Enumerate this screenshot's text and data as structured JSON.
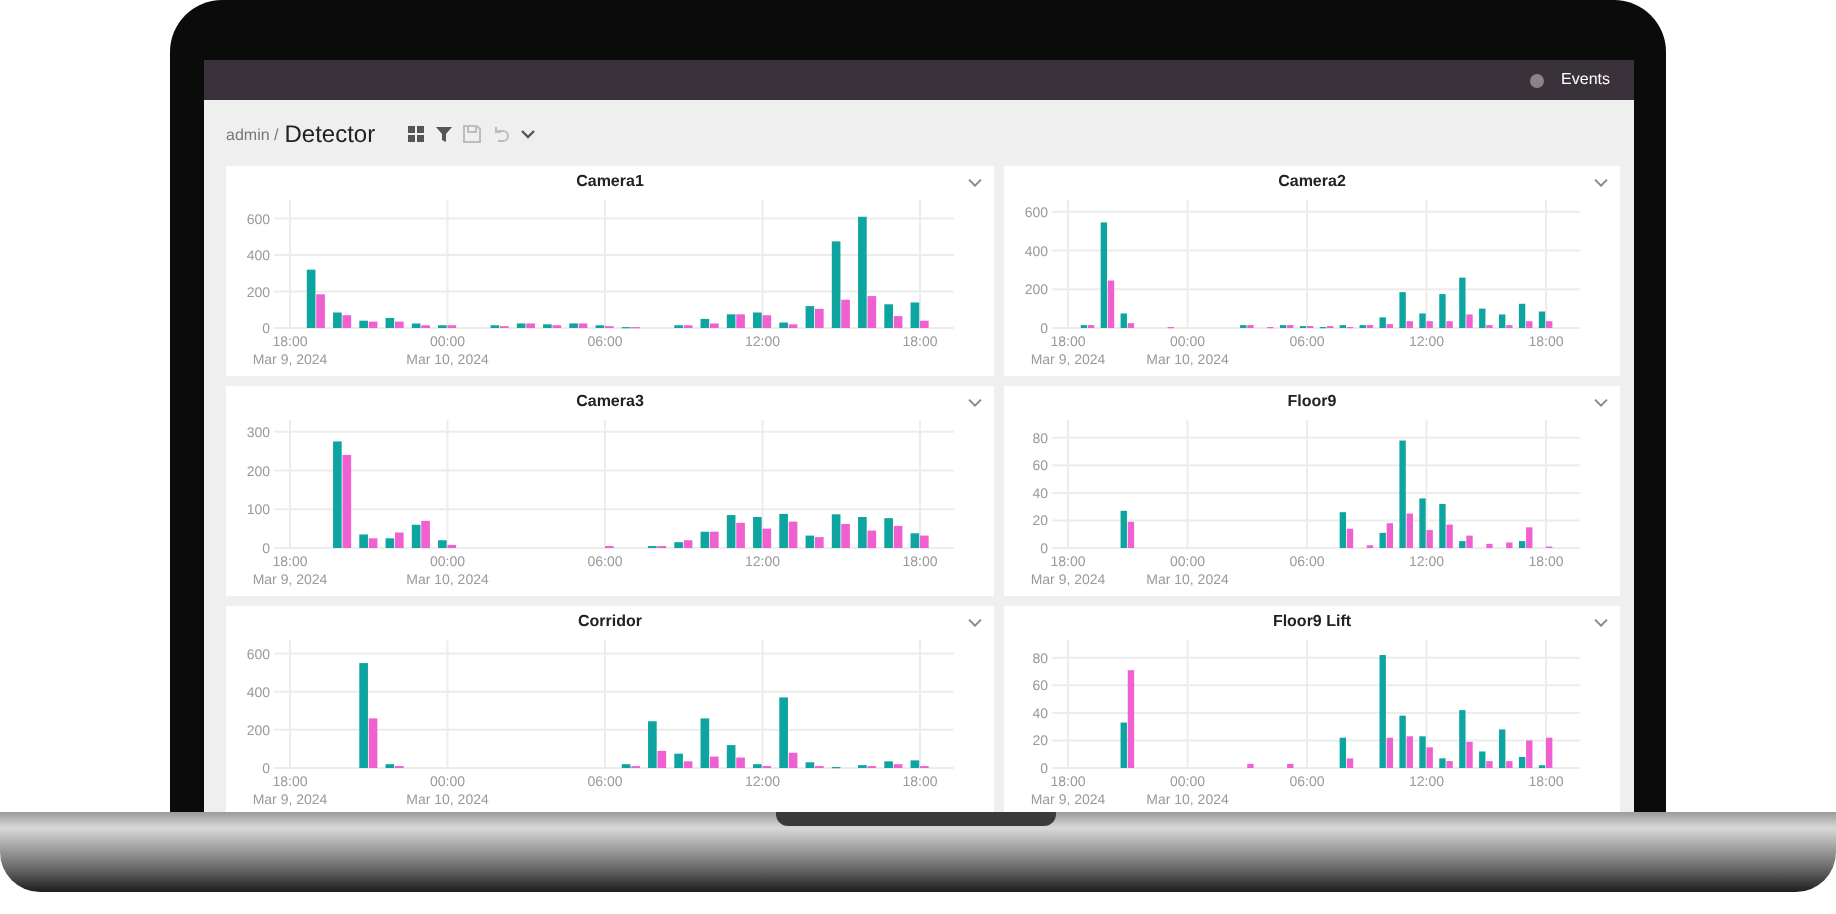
{
  "top_bar": {
    "link": "Events"
  },
  "breadcrumb": {
    "parent": "admin /",
    "current": "Detector"
  },
  "toolbar": [
    {
      "kind": "layout",
      "disabled": false
    },
    {
      "kind": "filter",
      "disabled": false
    },
    {
      "kind": "save",
      "disabled": true
    },
    {
      "kind": "undo",
      "disabled": true
    },
    {
      "kind": "more",
      "disabled": false
    }
  ],
  "panels": [
    {
      "title": "Camera1",
      "chart_data": {
        "type": "bar",
        "grid": true,
        "categories": [
          "18:00",
          null,
          null,
          null,
          null,
          null,
          "00:00",
          null,
          null,
          null,
          null,
          null,
          "06:00",
          null,
          null,
          null,
          null,
          null,
          "12:00",
          null,
          null,
          null,
          null,
          null,
          "18:00"
        ],
        "ylim": [
          0,
          680
        ],
        "yticks": [
          0,
          200,
          400,
          600
        ],
        "annotations": [
          "Mar 9, 2024",
          "Mar 10, 2024"
        ],
        "series": [
          {
            "color": "#0ea5a0",
            "values": [
              null,
              320,
              85,
              40,
              55,
              25,
              15,
              null,
              15,
              25,
              20,
              25,
              15,
              5,
              null,
              15,
              50,
              75,
              85,
              30,
              120,
              475,
              610,
              130,
              140
            ]
          },
          {
            "color": "#f060d0",
            "values": [
              null,
              185,
              70,
              35,
              35,
              15,
              15,
              null,
              10,
              25,
              15,
              25,
              10,
              5,
              null,
              15,
              25,
              75,
              70,
              20,
              105,
              155,
              175,
              65,
              40
            ]
          }
        ]
      }
    },
    {
      "title": "Camera2",
      "chart_data": {
        "type": "bar",
        "grid": true,
        "categories": [
          "18:00",
          null,
          null,
          null,
          null,
          null,
          "00:00",
          null,
          null,
          null,
          null,
          null,
          "06:00",
          null,
          null,
          null,
          null,
          null,
          "12:00",
          null,
          null,
          null,
          null,
          null,
          "18:00"
        ],
        "ylim": [
          0,
          640
        ],
        "yticks": [
          0,
          200,
          400,
          600
        ],
        "annotations": [
          "Mar 9, 2024",
          "Mar 10, 2024"
        ],
        "series": [
          {
            "color": "#0ea5a0",
            "values": [
              null,
              15,
              545,
              75,
              null,
              null,
              null,
              null,
              null,
              15,
              null,
              15,
              10,
              5,
              15,
              15,
              55,
              185,
              75,
              175,
              260,
              100,
              70,
              125,
              85
            ]
          },
          {
            "color": "#f060d0",
            "values": [
              null,
              15,
              245,
              25,
              null,
              5,
              null,
              null,
              null,
              15,
              5,
              15,
              10,
              10,
              5,
              15,
              20,
              35,
              35,
              35,
              70,
              15,
              15,
              35,
              35
            ]
          }
        ]
      }
    },
    {
      "title": "Camera3",
      "chart_data": {
        "type": "bar",
        "grid": true,
        "categories": [
          "18:00",
          null,
          null,
          null,
          null,
          null,
          "00:00",
          null,
          null,
          null,
          null,
          null,
          "06:00",
          null,
          null,
          null,
          null,
          null,
          "12:00",
          null,
          null,
          null,
          null,
          null,
          "18:00"
        ],
        "ylim": [
          0,
          320
        ],
        "yticks": [
          0,
          100,
          200,
          300
        ],
        "annotations": [
          "Mar 9, 2024",
          "Mar 10, 2024"
        ],
        "series": [
          {
            "color": "#0ea5a0",
            "values": [
              null,
              null,
              275,
              35,
              25,
              60,
              20,
              null,
              null,
              null,
              null,
              null,
              null,
              null,
              5,
              15,
              42,
              85,
              80,
              88,
              32,
              87,
              80,
              77,
              38
            ]
          },
          {
            "color": "#f060d0",
            "values": [
              null,
              null,
              240,
              25,
              40,
              70,
              8,
              null,
              null,
              null,
              null,
              null,
              5,
              null,
              5,
              20,
              42,
              65,
              50,
              68,
              28,
              62,
              45,
              57,
              32
            ]
          }
        ]
      }
    },
    {
      "title": "Floor9",
      "chart_data": {
        "type": "bar",
        "grid": true,
        "categories": [
          "18:00",
          null,
          null,
          null,
          null,
          null,
          "00:00",
          null,
          null,
          null,
          null,
          null,
          "06:00",
          null,
          null,
          null,
          null,
          null,
          "12:00",
          null,
          null,
          null,
          null,
          null,
          "18:00"
        ],
        "ylim": [
          0,
          90
        ],
        "yticks": [
          0,
          20,
          40,
          60,
          80
        ],
        "annotations": [
          "Mar 9, 2024",
          "Mar 10, 2024"
        ],
        "series": [
          {
            "color": "#0ea5a0",
            "values": [
              null,
              null,
              null,
              27,
              null,
              null,
              null,
              null,
              null,
              null,
              null,
              null,
              null,
              null,
              26,
              null,
              11,
              78,
              36,
              32,
              5,
              null,
              null,
              5,
              null
            ]
          },
          {
            "color": "#f060d0",
            "values": [
              null,
              null,
              null,
              19,
              null,
              null,
              null,
              null,
              null,
              null,
              null,
              null,
              null,
              null,
              14,
              2,
              18,
              25,
              13,
              17,
              9,
              3,
              4,
              15,
              1
            ]
          }
        ]
      }
    },
    {
      "title": "Corridor",
      "chart_data": {
        "type": "bar",
        "grid": true,
        "categories": [
          "18:00",
          null,
          null,
          null,
          null,
          null,
          "00:00",
          null,
          null,
          null,
          null,
          null,
          "06:00",
          null,
          null,
          null,
          null,
          null,
          "12:00",
          null,
          null,
          null,
          null,
          null,
          "18:00"
        ],
        "ylim": [
          0,
          650
        ],
        "yticks": [
          0,
          200,
          400,
          600
        ],
        "annotations": [
          "Mar 9, 2024",
          "Mar 10, 2024"
        ],
        "series": [
          {
            "color": "#0ea5a0",
            "values": [
              null,
              null,
              null,
              550,
              20,
              null,
              null,
              null,
              null,
              null,
              null,
              null,
              null,
              20,
              245,
              75,
              260,
              120,
              20,
              370,
              30,
              5,
              15,
              35,
              40
            ]
          },
          {
            "color": "#f060d0",
            "values": [
              null,
              null,
              null,
              260,
              10,
              null,
              null,
              null,
              null,
              null,
              null,
              null,
              null,
              10,
              90,
              35,
              60,
              55,
              10,
              80,
              10,
              null,
              10,
              20,
              10
            ]
          }
        ]
      }
    },
    {
      "title": "Floor9 Lift",
      "chart_data": {
        "type": "bar",
        "grid": true,
        "categories": [
          "18:00",
          null,
          null,
          null,
          null,
          null,
          "00:00",
          null,
          null,
          null,
          null,
          null,
          "06:00",
          null,
          null,
          null,
          null,
          null,
          "12:00",
          null,
          null,
          null,
          null,
          null,
          "18:00"
        ],
        "ylim": [
          0,
          90
        ],
        "yticks": [
          0,
          20,
          40,
          60,
          80
        ],
        "annotations": [
          "Mar 9, 2024",
          "Mar 10, 2024"
        ],
        "series": [
          {
            "color": "#0ea5a0",
            "values": [
              null,
              null,
              null,
              33,
              null,
              null,
              null,
              null,
              null,
              null,
              null,
              null,
              null,
              null,
              22,
              null,
              82,
              38,
              23,
              7,
              42,
              12,
              28,
              8,
              2
            ]
          },
          {
            "color": "#f060d0",
            "values": [
              null,
              null,
              null,
              71,
              null,
              null,
              null,
              null,
              null,
              3,
              null,
              3,
              null,
              null,
              7,
              null,
              22,
              23,
              15,
              5,
              19,
              5,
              5,
              20,
              22
            ]
          }
        ]
      }
    }
  ]
}
